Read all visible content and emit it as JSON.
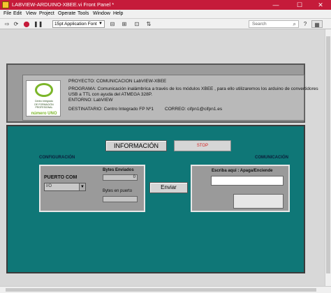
{
  "window": {
    "title": "LABVIEW-ARDUINO-XBEE.vi Front Panel *",
    "minimize": "—",
    "maximize": "☐",
    "close": "✕"
  },
  "menu": [
    "File",
    "Edit",
    "View",
    "Project",
    "Operate",
    "Tools",
    "Window",
    "Help"
  ],
  "toolbar": {
    "font": "15pt Application Font",
    "search_placeholder": "Search"
  },
  "info": {
    "logo_text": [
      "Centro Integrado",
      "DE FORMACIÓN PROFESIONAL"
    ],
    "logo_brand": "número UNO",
    "proyecto": "PROYECTO: COMUNICACION LabVIEW-XBEE",
    "programa_1": "PROGRAMA: Comunicación inalámbrica a través de los módulos XBEE , para ello utilizaremos los arduino de convertidores",
    "programa_2": "USB a TTL con ayuda del ATMEGA 328P.",
    "entorno": "ENTORNO: LabVIEW",
    "destinatario": "DESTINATARIO: Centro Integrado FP Nº1",
    "correo": "CORREO:   cifpn1@cifpn1.es"
  },
  "controls": {
    "info_button": "INFORMACIÓN",
    "stop_button": "STOP",
    "config_label": "CONFIGURACIÓN",
    "comm_label": "COMUNICACIÓN",
    "puerto_label": "PUERTO COM",
    "puerto_value": "I/O",
    "bytes_sent_label": "Bytes Enviados",
    "bytes_sent_value": "0",
    "bytes_port_label": "Bytes en puerto",
    "bytes_port_value": "",
    "send_button": "Enviar",
    "write_label": "Escriba aqui : Apaga/Enciende",
    "write_value": "",
    "read_value": ""
  },
  "colors": {
    "titlebar": "#c51b3a",
    "panel": "#0f7777",
    "stop_text": "#d32020"
  }
}
